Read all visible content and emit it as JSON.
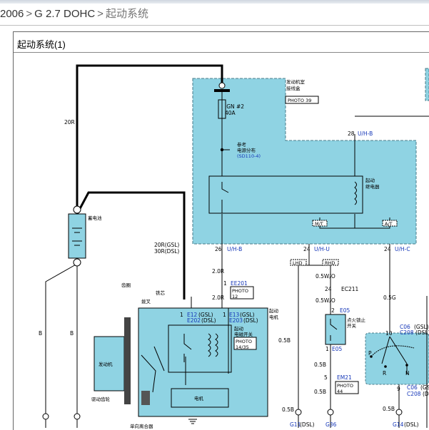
{
  "header": {
    "crumbs": [
      "2006",
      "G 2.7 DOHC",
      "起动系统"
    ]
  },
  "document": {
    "title": "起动系统(1)"
  },
  "diagram": {
    "labels": {
      "engine_room_box": [
        "发动机室",
        "接线盒"
      ],
      "photo39": "PHOTO 39",
      "ign": "IGN #2",
      "amp": "40A",
      "ref": [
        "参考",
        "电源分布"
      ],
      "ref_code": "(SD110-4)",
      "relay": [
        "起动",
        "继电器"
      ],
      "battery": "蓄电池",
      "wire_20r_left": "20R",
      "wire_20r_gsl": "20R(GSL)",
      "wire_30r_dsl": "30R(DSL)",
      "p26": "26",
      "p26_conn": "U/H-B",
      "p28": "28",
      "p28_conn": "U/H-B",
      "p24a": "24",
      "p24a_conn": "U/H-U",
      "p24b": "24",
      "p24b_conn": "U/H-C",
      "mt": "M/T",
      "at": "A/T",
      "lhd": "LHD",
      "rhd": "RHD",
      "w_20r": "2.0R",
      "ee201": "EE201",
      "photo12": [
        "PHOTO",
        "12"
      ],
      "w_20r_b": "2.0R",
      "w_05wo": "0.5W/O",
      "ec211_pin": "24",
      "ec211": "EC211",
      "w_05wo_b": "0.5W/O",
      "w_05g": "0.5G",
      "e05_pin": "2",
      "e05": "E05",
      "e05_pin_b": "1",
      "e05_b": "E05",
      "clutch": [
        "点火锁止",
        "开关"
      ],
      "w_05b_1": "0.5B",
      "w_05b_2": "0.5B",
      "w_05b_3": "0.5B",
      "w_05b_4": "0.5B",
      "w_05b_5": "0.5B",
      "em21_pin": "5",
      "em21": "EM21",
      "photo44": [
        "PHOTO",
        "44"
      ],
      "starter_motor": [
        "起动",
        "电机"
      ],
      "gear_ring": "齿圈",
      "iron_core": "铁芯",
      "fork": "拨叉",
      "engine": "发动机",
      "drive_gear": "驱动齿轮",
      "one_way_clutch": "单向离合器",
      "motor": "电机",
      "solenoid": [
        "起动",
        "电磁开关"
      ],
      "photo14": [
        "PHOTO",
        "14/35"
      ],
      "e12_pin": "1",
      "e12": "E12",
      "e12_gsl": "(GSL)",
      "e202": "E202",
      "e202_dsl": "(DSL)",
      "e13_pin": "1",
      "e13": "E13",
      "e13_gsl": "(GSL)",
      "e203": "E203",
      "e203_dsl": "(DSL)",
      "c06_pin": "10",
      "c06": "C06",
      "c06_gsl": "(GSL)",
      "c208": "C208",
      "c208_dsl": "(DSL)",
      "c06b_pin": "9",
      "c06b": "C06",
      "c06b_gsl": "(GSL)",
      "c208b": "C208",
      "c208b_dsl": "(DSL)",
      "pos_p": "P",
      "pos_r": "R",
      "pos_n": "N",
      "ground_b_1": "B",
      "ground_b_2": "B",
      "g11": "G11",
      "g11_dsl": "(DSL)",
      "g36": "G36",
      "g14": "G14",
      "g14_dsl": "(DSL)"
    }
  },
  "colors": {
    "box_fill": "#8fd3e3",
    "link_blue": "#1436b8",
    "wire_black": "#000000"
  }
}
